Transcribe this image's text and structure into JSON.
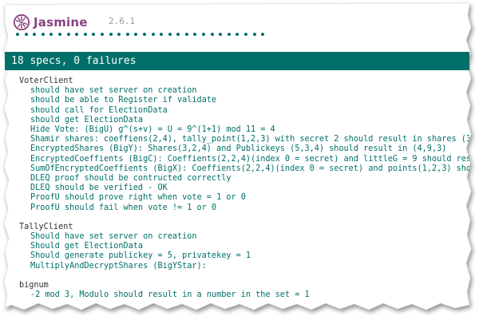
{
  "banner": {
    "logo_text": "Jasmine",
    "version": "2.6.1",
    "dot_count": 30,
    "accent_color": "#8a4182",
    "pass_color": "#007069"
  },
  "summary": {
    "text": "18 specs, 0 failures"
  },
  "suites": [
    {
      "title": "VoterClient",
      "specs": [
        "should have set server on creation",
        "should be able to Register if validate",
        "should call for ElectionData",
        "should get ElectionData",
        "Hide Vote: (BigU) g^(s+v) = U = 9^(1+1) mod 11 = 4",
        "Shamir shares: coeffiens(2,4), tally_point(1,2,3) with secret 2 should result in shares (3,",
        "EncryptedShares (BigY): Shares(3,2,4) and Publickeys (5,3,4) should result in (4,9,3)",
        "EncryptedCoeffients (BigC): Coeffients(2,2,4)(index 0 = secret) and littleG = 9 should resu",
        "SumOfEncryptedCoeffients (BigX): Coeffients(2,2,4)(index 0 = secret) and points(1,2,3) shou",
        "DLEQ proof should be contructed correctly",
        "DLEQ should be verified - OK",
        "ProofU should prove right when vote = 1 or 0",
        "ProofU should fail when vote != 1 or 0"
      ]
    },
    {
      "title": "TallyClient",
      "specs": [
        "Should have set server on creation",
        "Should get ElectionData",
        "Should generate publickey = 5, privatekey = 1",
        "MultiplyAndDecryptShares (BigYStar):"
      ]
    },
    {
      "title": "bignum",
      "specs": [
        "-2 mod 3, Modulo should result in a number in the set = 1"
      ]
    }
  ]
}
